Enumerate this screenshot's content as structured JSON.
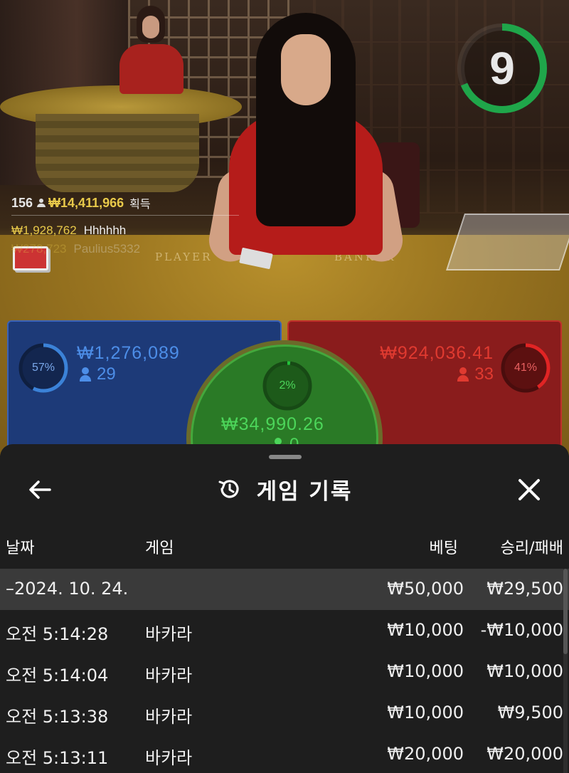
{
  "timer": {
    "seconds": "9",
    "color": "#1fa64a"
  },
  "winners": {
    "count": "156",
    "total": "₩14,411,966",
    "label": "획득",
    "items": [
      {
        "amount": "₩1,928,762",
        "name": "Hhhhhh"
      },
      {
        "amount": "₩278,723",
        "name": "Paulius5332"
      }
    ]
  },
  "table_text": {
    "player": "PLAYER",
    "banker": "BANKER"
  },
  "bets": {
    "player": {
      "percent": "57%",
      "amount": "₩1,276,089",
      "users": "29",
      "color": "#3b82d8"
    },
    "tie": {
      "percent": "2%",
      "amount": "₩34,990.26",
      "users": "0",
      "color": "#22c23a"
    },
    "banker": {
      "percent": "41%",
      "amount": "₩924,036.41",
      "users": "33",
      "color": "#e02424"
    }
  },
  "history": {
    "title": "게임 기록",
    "icons": {
      "back": "back-arrow-icon",
      "history": "history-clock-icon",
      "close": "close-icon"
    },
    "columns": {
      "date": "날짜",
      "game": "게임",
      "bet": "베팅",
      "result": "승리/패배"
    },
    "date_group": {
      "date": "–2024. 10. 24.",
      "bet": "₩50,000",
      "result": "₩29,500"
    },
    "rows": [
      {
        "time": "오전 5:14:28",
        "game": "바카라",
        "bet": "₩10,000",
        "result": "-₩10,000"
      },
      {
        "time": "오전 5:14:04",
        "game": "바카라",
        "bet": "₩10,000",
        "result": "₩10,000"
      },
      {
        "time": "오전 5:13:38",
        "game": "바카라",
        "bet": "₩10,000",
        "result": "₩9,500"
      },
      {
        "time": "오전 5:13:11",
        "game": "바카라",
        "bet": "₩20,000",
        "result": "₩20,000"
      }
    ]
  }
}
